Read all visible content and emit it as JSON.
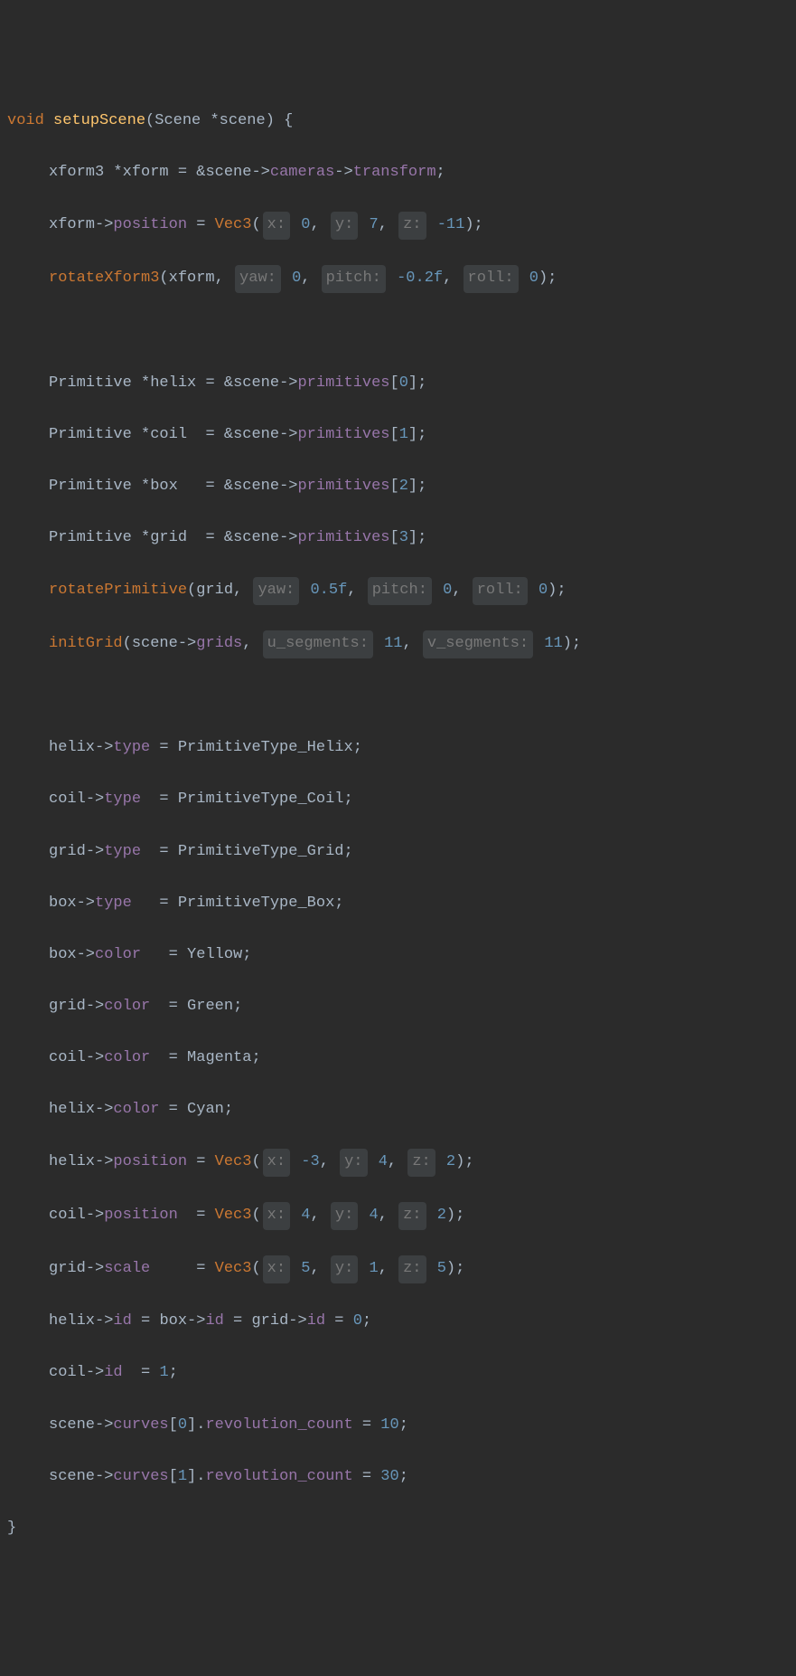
{
  "colors": {
    "keyword": "#cc7832",
    "function": "#ffc66d",
    "member": "#9876aa",
    "number": "#6897bb",
    "text": "#a9b7c6",
    "hint_bg": "#3c3f41",
    "hint_fg": "#787878",
    "bg": "#2b2b2b"
  },
  "fn_name": "setupScene",
  "ret": "void",
  "param_type": "Scene",
  "param_name": "scene",
  "lines": {
    "l1_t1": "xform3",
    "l1_t2": "xform",
    "l1_t3": "scene",
    "l1_m1": "cameras",
    "l1_m2": "transform",
    "l2_t1": "xform",
    "l2_m1": "position",
    "l2_fn": "Vec3",
    "l2_h1": "x:",
    "l2_v1": "0",
    "l2_h2": "y:",
    "l2_v2": "7",
    "l2_h3": "z:",
    "l2_v3": "-11",
    "l3_fn": "rotateXform3",
    "l3_t1": "xform",
    "l3_h1": "yaw:",
    "l3_v1": "0",
    "l3_h2": "pitch:",
    "l3_v2": "-0.2f",
    "l3_h3": "roll:",
    "l3_v3": "0",
    "l4_t1": "Primitive",
    "l4_t2": "helix",
    "l4_t3": "scene",
    "l4_m1": "primitives",
    "l4_v1": "0",
    "l5_t2": "coil",
    "l5_v1": "1",
    "l6_t2": "box",
    "l6_v1": "2",
    "l7_t2": "grid",
    "l7_v1": "3",
    "l8_fn": "rotatePrimitive",
    "l8_t1": "grid",
    "l8_h1": "yaw:",
    "l8_v1": "0.5f",
    "l8_h2": "pitch:",
    "l8_v2": "0",
    "l8_h3": "roll:",
    "l8_v3": "0",
    "l9_fn": "initGrid",
    "l9_t1": "scene",
    "l9_m1": "grids",
    "l9_h1": "u_segments:",
    "l9_v1": "11",
    "l9_h2": "v_segments:",
    "l9_v2": "11",
    "l10_t1": "helix",
    "l10_m1": "type",
    "l10_t2": "PrimitiveType_Helix",
    "l11_t1": "coil",
    "l11_m1": "type",
    "l11_t2": "PrimitiveType_Coil",
    "l12_t1": "grid",
    "l12_m1": "type",
    "l12_t2": "PrimitiveType_Grid",
    "l13_t1": "box",
    "l13_m1": "type",
    "l13_t2": "PrimitiveType_Box",
    "l14_t1": "box",
    "l14_m1": "color",
    "l14_t2": "Yellow",
    "l15_t1": "grid",
    "l15_m1": "color",
    "l15_t2": "Green",
    "l16_t1": "coil",
    "l16_m1": "color",
    "l16_t2": "Magenta",
    "l17_t1": "helix",
    "l17_m1": "color",
    "l17_t2": "Cyan",
    "l18_t1": "helix",
    "l18_m1": "position",
    "l18_fn": "Vec3",
    "l18_h1": "x:",
    "l18_v1": "-3",
    "l18_h2": "y:",
    "l18_v2": "4",
    "l18_h3": "z:",
    "l18_v3": "2",
    "l19_t1": "coil",
    "l19_m1": "position",
    "l19_v1": "4",
    "l19_v2": "4",
    "l19_v3": "2",
    "l20_t1": "grid",
    "l20_m1": "scale",
    "l20_v1": "5",
    "l20_v2": "1",
    "l20_v3": "5",
    "l21_t1": "helix",
    "l21_m1": "id",
    "l21_t2": "box",
    "l21_t3": "grid",
    "l21_v1": "0",
    "l22_t1": "coil",
    "l22_m1": "id",
    "l22_v1": "1",
    "l23_t1": "scene",
    "l23_m1": "curves",
    "l23_v1": "0",
    "l23_m2": "revolution_count",
    "l23_v2": "10",
    "l24_v1": "1",
    "l24_v2": "30"
  }
}
